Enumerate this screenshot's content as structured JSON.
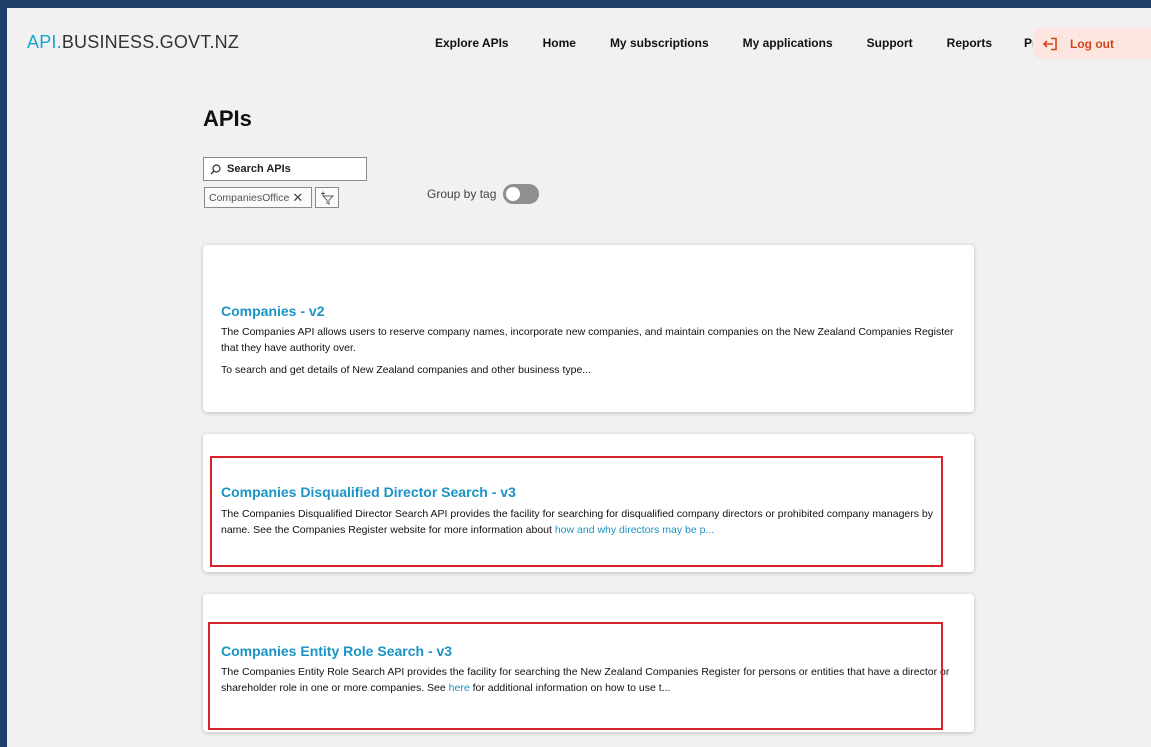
{
  "logo": {
    "part1": "API.",
    "part2": "BUSINESS.GOVT.NZ"
  },
  "nav": {
    "items": [
      "Explore APIs",
      "Home",
      "My subscriptions",
      "My applications",
      "Support",
      "Reports",
      "Profile"
    ],
    "logout_label": "Log out"
  },
  "page": {
    "title": "APIs"
  },
  "search": {
    "placeholder": "Search APIs"
  },
  "filter_chip": {
    "label": "CompaniesOffice"
  },
  "group_by": {
    "label": "Group by tag",
    "enabled": false
  },
  "apis": [
    {
      "title": "Companies - v2",
      "desc1": "The Companies API allows users to reserve company names, incorporate new companies, and maintain companies on the New Zealand Companies Register that they have authority over.",
      "desc2": "To search and get details of New Zealand companies and other business type..."
    },
    {
      "title": "Companies Disqualified Director Search - v3",
      "desc": "The Companies Disqualified Director Search API provides the facility for searching for disqualified company directors or prohibited company managers by name. See the Companies Register website for more information about",
      "link": "how and why directors may be p..."
    },
    {
      "title": "Companies Entity Role Search - v3",
      "desc_before": "The Companies Entity Role Search API provides the facility for searching the New Zealand Companies Register for persons or entities that have a director or shareholder role in one or more companies. See",
      "link": "here",
      "desc_after": "for additional information on how to use t..."
    }
  ],
  "colors": {
    "accent": "#1a93c5",
    "highlight": "#d7232c",
    "logout": "#d2461b",
    "frame": "#1f3f6b"
  }
}
